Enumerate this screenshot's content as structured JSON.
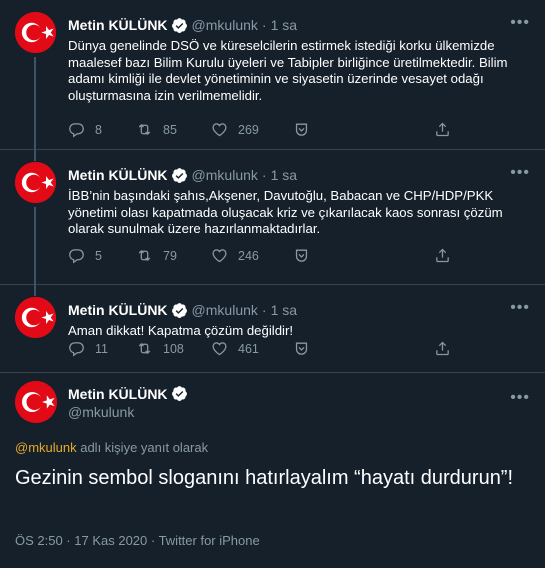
{
  "colors": {
    "background": "#15202b",
    "secondary_text": "#8899a6",
    "mention": "#e6a92b",
    "verified": "#1da1f2",
    "avatar_red": "#e30a17"
  },
  "author": {
    "name": "Metin KÜLÜNK",
    "handle": "@mkulunk"
  },
  "tweets": [
    {
      "name": "Metin KÜLÜNK",
      "handle": "@mkulunk",
      "separator": "·",
      "time": "1 sa",
      "text": "Dünya genelinde DSÖ ve küreselcilerin estirmek istediği  korku ülkemizde maalesef bazı Bilim Kurulu üyeleri ve Tabipler birliğince üretilmektedir. Bilim adamı kimliği ile devlet yönetiminin ve siyasetin üzerinde vesayet odağı oluşturmasına izin verilmemelidir.",
      "replies": "8",
      "retweets": "85",
      "likes": "269"
    },
    {
      "name": "Metin KÜLÜNK",
      "handle": "@mkulunk",
      "separator": "·",
      "time": "1 sa",
      "text": "İBB’nin başındaki şahıs,Akşener, Davutoğlu, Babacan ve CHP/HDP/PKK yönetimi olası kapatmada oluşacak kriz ve çıkarılacak kaos sonrası çözüm olarak sunulmak üzere hazırlanmaktadırlar.",
      "replies": "5",
      "retweets": "79",
      "likes": "246"
    },
    {
      "name": "Metin KÜLÜNK",
      "handle": "@mkulunk",
      "separator": "·",
      "time": "1 sa",
      "text": "Aman dikkat! Kapatma çözüm değildir!",
      "replies": "11",
      "retweets": "108",
      "likes": "461"
    }
  ],
  "main_tweet": {
    "name": "Metin KÜLÜNK",
    "handle": "@mkulunk",
    "reply_mention": "@mkulunk",
    "reply_suffix": " adlı kişiye yanıt olarak",
    "text": "Gezinin sembol sloganını hatırlayalım “hayatı durdurun”!",
    "meta": "ÖS 2:50 · 17 Kas 2020 · Twitter for iPhone"
  },
  "icons": {
    "reply": "reply-icon",
    "retweet": "retweet-icon",
    "like": "heart-icon",
    "save": "bookmark-icon",
    "share": "share-icon",
    "more": "more-icon",
    "verified": "verified-badge-icon"
  }
}
